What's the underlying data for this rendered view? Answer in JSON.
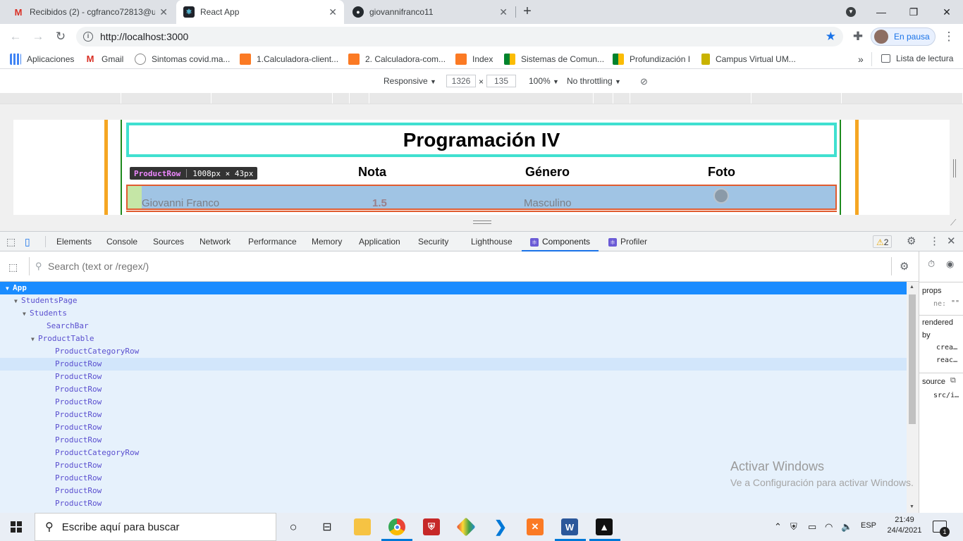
{
  "browser": {
    "tabs": [
      {
        "title": "Recibidos (2) - cgfranco72813@u",
        "icon": "gmail-icon",
        "active": false
      },
      {
        "title": "React App",
        "icon": "react-icon",
        "active": true
      },
      {
        "title": "giovannifranco11",
        "icon": "github-icon",
        "active": false
      }
    ],
    "new_tab": "+",
    "url": "http://localhost:3000",
    "profile_label": "En pausa",
    "bookmarks": [
      {
        "label": "Aplicaciones",
        "icon": "apps-icon"
      },
      {
        "label": "Gmail",
        "icon": "gmail-icon"
      },
      {
        "label": "Sintomas covid.ma...",
        "icon": "doc-icon"
      },
      {
        "label": "1.Calculadora-client...",
        "icon": "xampp-icon"
      },
      {
        "label": "2. Calculadora-com...",
        "icon": "xampp-icon"
      },
      {
        "label": "Index",
        "icon": "xampp-icon"
      },
      {
        "label": "Sistemas de Comun...",
        "icon": "meet-icon"
      },
      {
        "label": "Profundización I",
        "icon": "meet-icon"
      },
      {
        "label": "Campus Virtual UM...",
        "icon": "campus-icon"
      }
    ],
    "reading_list": "Lista de lectura",
    "overflow": "»"
  },
  "device_toolbar": {
    "mode": "Responsive",
    "width": "1326",
    "height": "135",
    "times": "×",
    "zoom": "100%",
    "throttling": "No throttling"
  },
  "page": {
    "title": "Programación IV",
    "headers": [
      "Nota",
      "Género",
      "Foto"
    ],
    "row": {
      "name": "Giovanni Franco",
      "grade": "1.5",
      "gender": "Masculino"
    },
    "tooltip": {
      "component": "ProductRow",
      "size": "1008px × 43px"
    }
  },
  "devtools": {
    "tabs": [
      "Elements",
      "Console",
      "Sources",
      "Network",
      "Performance",
      "Memory",
      "Application",
      "Security",
      "Lighthouse",
      "Components",
      "Profiler"
    ],
    "active_tab": "Components",
    "warnings": "2",
    "search_placeholder": "Search (text or /regex/)",
    "tree": [
      {
        "label": "App",
        "depth": 0,
        "caret": true
      },
      {
        "label": "StudentsPage",
        "depth": 1,
        "caret": true
      },
      {
        "label": "Students",
        "depth": 2,
        "caret": true
      },
      {
        "label": "SearchBar",
        "depth": 4,
        "caret": false
      },
      {
        "label": "ProductTable",
        "depth": 3,
        "caret": true
      },
      {
        "label": "ProductCategoryRow",
        "depth": 5,
        "caret": false
      },
      {
        "label": "ProductRow",
        "depth": 5,
        "caret": false
      },
      {
        "label": "ProductRow",
        "depth": 5,
        "caret": false
      },
      {
        "label": "ProductRow",
        "depth": 5,
        "caret": false
      },
      {
        "label": "ProductRow",
        "depth": 5,
        "caret": false
      },
      {
        "label": "ProductRow",
        "depth": 5,
        "caret": false
      },
      {
        "label": "ProductRow",
        "depth": 5,
        "caret": false
      },
      {
        "label": "ProductRow",
        "depth": 5,
        "caret": false
      },
      {
        "label": "ProductCategoryRow",
        "depth": 5,
        "caret": false
      },
      {
        "label": "ProductRow",
        "depth": 5,
        "caret": false
      },
      {
        "label": "ProductRow",
        "depth": 5,
        "caret": false
      },
      {
        "label": "ProductRow",
        "depth": 5,
        "caret": false
      },
      {
        "label": "ProductRow",
        "depth": 5,
        "caret": false
      }
    ],
    "side": {
      "props": "props",
      "prop_key": "ne:",
      "prop_val": "\"\"",
      "rendered": "rendered",
      "by": "by",
      "by1": "crea…",
      "by2": "reac…",
      "source": "source",
      "source_val": "src/i…"
    }
  },
  "watermark": {
    "line1": "Activar Windows",
    "line2": "Ve a Configuración para activar Windows."
  },
  "taskbar": {
    "search_placeholder": "Escribe aquí para buscar",
    "lang": "ESP",
    "time": "21:49",
    "date": "24/4/2021",
    "notifications": "1"
  }
}
